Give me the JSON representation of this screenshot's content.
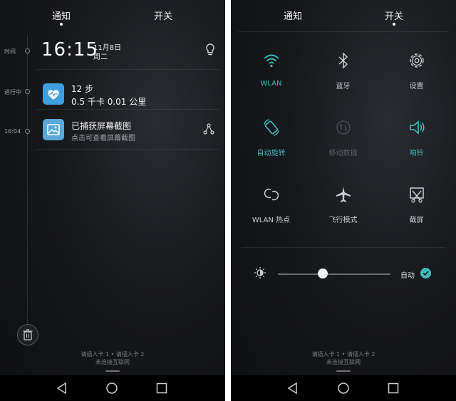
{
  "left": {
    "tabs": {
      "notifications": "通知",
      "switches": "开关"
    },
    "timeline": {
      "time_label": "时间",
      "ongoing_label": "进行中",
      "event_time": "16:04"
    },
    "clock": {
      "time": "16:15",
      "date": "11月8日",
      "weekday": "周二"
    },
    "notifications": [
      {
        "title": "12 步",
        "detail": "0.5 千卡  0.01 公里",
        "icon": "health-heart-icon",
        "accent": "#3d9fe0"
      },
      {
        "title": "已捕获屏幕截图",
        "detail": "点击可查看屏幕截图",
        "icon": "image-icon",
        "accent": "#5ba7d8"
      }
    ],
    "sim": {
      "line1": "请插入卡 1 • 请插入卡 2",
      "line2": "未连接互联网"
    }
  },
  "right": {
    "tabs": {
      "notifications": "通知",
      "switches": "开关"
    },
    "toggles": [
      {
        "label": "WLAN",
        "state": "on",
        "icon": "wifi-icon"
      },
      {
        "label": "蓝牙",
        "state": "normal",
        "icon": "bluetooth-icon"
      },
      {
        "label": "设置",
        "state": "normal",
        "icon": "gear-icon"
      },
      {
        "label": "自动旋转",
        "state": "on",
        "icon": "auto-rotate-icon"
      },
      {
        "label": "移动数据",
        "state": "disabled",
        "icon": "mobile-data-icon"
      },
      {
        "label": "响铃",
        "state": "on",
        "icon": "speaker-icon"
      },
      {
        "label": "WLAN 热点",
        "state": "normal",
        "icon": "hotspot-icon"
      },
      {
        "label": "飞行模式",
        "state": "normal",
        "icon": "airplane-icon"
      },
      {
        "label": "截屏",
        "state": "normal",
        "icon": "screenshot-icon"
      }
    ],
    "brightness": {
      "auto_label": "自动",
      "auto_checked": true,
      "level": 0.4
    },
    "sim": {
      "line1": "请插入卡 1 • 请插入卡 2",
      "line2": "未连接互联网"
    }
  },
  "colors": {
    "accent": "#3fbcc0",
    "navbar": "#000000"
  }
}
